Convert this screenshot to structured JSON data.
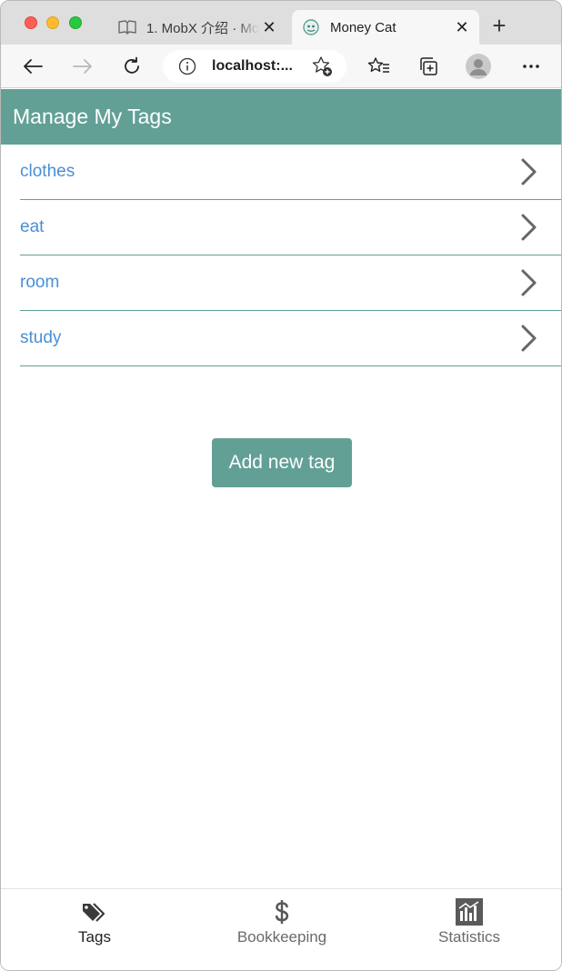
{
  "browser": {
    "tabs": [
      {
        "title": "1. MobX 介绍 · Mo",
        "icon": "book-icon",
        "active": false
      },
      {
        "title": "Money Cat",
        "icon": "app-favicon-icon",
        "active": true
      }
    ],
    "new_tab": "+",
    "address": "localhost:..."
  },
  "app": {
    "header_title": "Manage My Tags",
    "tags": [
      {
        "name": "clothes"
      },
      {
        "name": "eat"
      },
      {
        "name": "room"
      },
      {
        "name": "study"
      }
    ],
    "add_button": "Add new tag",
    "nav": [
      {
        "label": "Tags",
        "icon": "tags-icon",
        "selected": true
      },
      {
        "label": "Bookkeeping",
        "icon": "dollar-icon",
        "selected": false
      },
      {
        "label": "Statistics",
        "icon": "chart-icon",
        "selected": false
      }
    ]
  },
  "colors": {
    "accent": "#62a096",
    "link": "#4a8fd6"
  }
}
